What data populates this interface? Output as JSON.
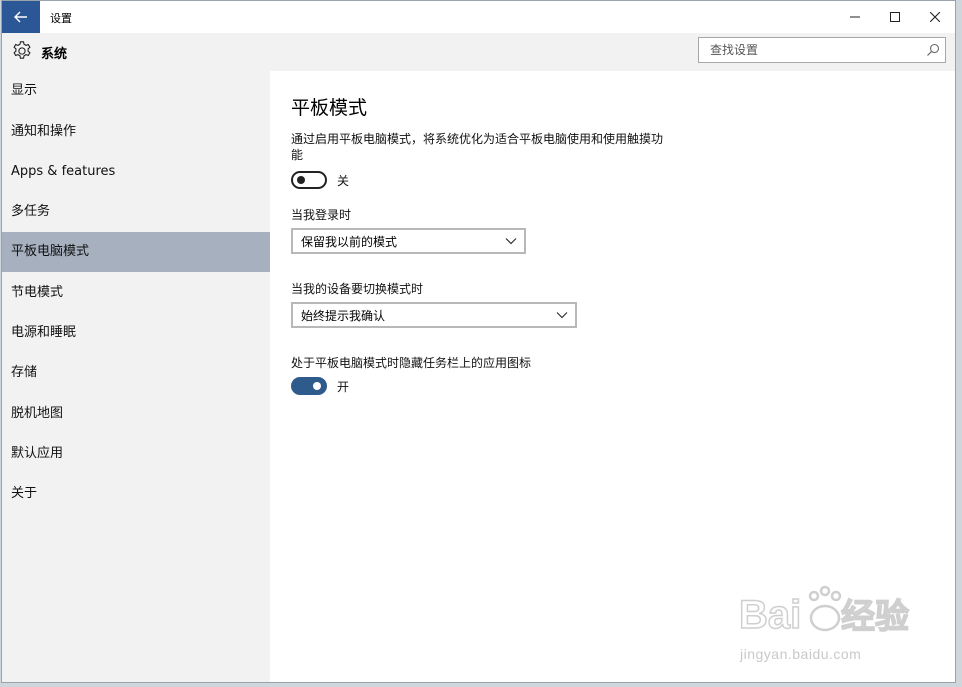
{
  "window": {
    "title": "设置"
  },
  "header": {
    "section": "系统",
    "search_placeholder": "查找设置"
  },
  "sidebar": {
    "items": [
      {
        "label": "显示"
      },
      {
        "label": "通知和操作"
      },
      {
        "label": "Apps & features"
      },
      {
        "label": "多任务"
      },
      {
        "label": "平板电脑模式",
        "active": true
      },
      {
        "label": "节电模式"
      },
      {
        "label": "电源和睡眠"
      },
      {
        "label": "存储"
      },
      {
        "label": "脱机地图"
      },
      {
        "label": "默认应用"
      },
      {
        "label": "关于"
      }
    ]
  },
  "main": {
    "title": "平板模式",
    "description": "通过启用平板电脑模式，将系统优化为适合平板电脑使用和使用触摸功能",
    "tablet_toggle": {
      "state": "off",
      "label": "关"
    },
    "signin_label": "当我登录时",
    "signin_value": "保留我以前的模式",
    "switch_label": "当我的设备要切换模式时",
    "switch_value": "始终提示我确认",
    "hide_icons_label": "处于平板电脑模式时隐藏任务栏上的应用图标",
    "hide_icons_toggle": {
      "state": "on",
      "label": "开"
    }
  },
  "watermark": {
    "url": "jingyan.baidu.com",
    "brand": "Baidu 经验"
  },
  "colors": {
    "accent": "#2b5797",
    "toggle_on": "#2f5b8c",
    "nav_active": "#a6b0bf"
  }
}
